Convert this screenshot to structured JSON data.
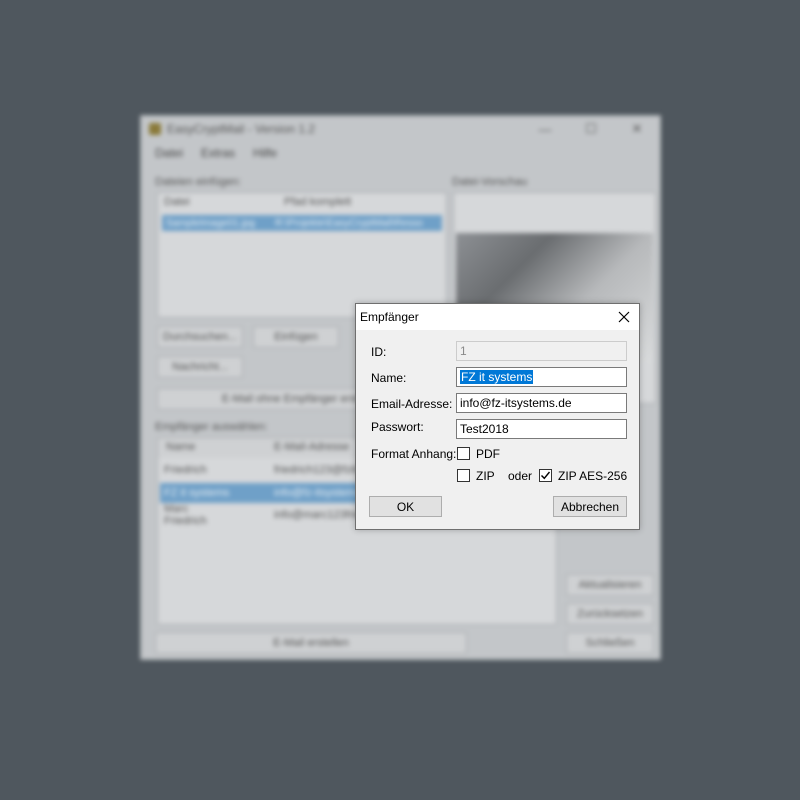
{
  "main_window": {
    "title": "EasyCryptMail - Version 1.2",
    "menu": [
      "Datei",
      "Extras",
      "Hilfe"
    ],
    "files_section_label": "Dateien einfügen:",
    "preview_label": "Datei-Vorschau",
    "file_columns": [
      "Datei",
      "Pfad komplett"
    ],
    "file_rows": [
      {
        "name": "SampleImage01.jpg",
        "path": "R:\\Projekte\\EasyCryptMail\\Resso"
      }
    ],
    "buttons": {
      "browse": "Durchsuchen...",
      "insert": "Einfügen",
      "message": "Nachricht...",
      "email_without_recipient": "E-Mail ohne Empfänger erstellen",
      "refresh": "Aktualisieren",
      "reset": "Zurücksetzen",
      "create_email": "E-Mail erstellen",
      "close": "Schließen"
    },
    "recipients_label": "Empfänger auswählen:",
    "recipient_columns": [
      "Name",
      "E-Mail-Adresse"
    ],
    "recipient_rows": [
      {
        "name": "Friedrich",
        "email": "friedrich123@fzitsystems.de"
      },
      {
        "name": "FZ it systems",
        "email": "info@fz-itsystems.de"
      },
      {
        "name": "Marc Friedrich",
        "email": "info@marc123friedrich.de"
      }
    ]
  },
  "dialog": {
    "title": "Empfänger",
    "fields": {
      "id": {
        "label": "ID:",
        "value": "1"
      },
      "name": {
        "label": "Name:",
        "value": "FZ it systems"
      },
      "email": {
        "label": "Email-Adresse:",
        "value": "info@fz-itsystems.de"
      },
      "password": {
        "label": "Passwort:",
        "value": "Test2018"
      }
    },
    "format_label": "Format Anhang:",
    "options": {
      "pdf": {
        "label": "PDF",
        "checked": false
      },
      "zip": {
        "label": "ZIP",
        "checked": false
      },
      "or_text": "oder",
      "zip_aes": {
        "label": "ZIP AES-256",
        "checked": true
      }
    },
    "ok_label": "OK",
    "cancel_label": "Abbrechen"
  }
}
